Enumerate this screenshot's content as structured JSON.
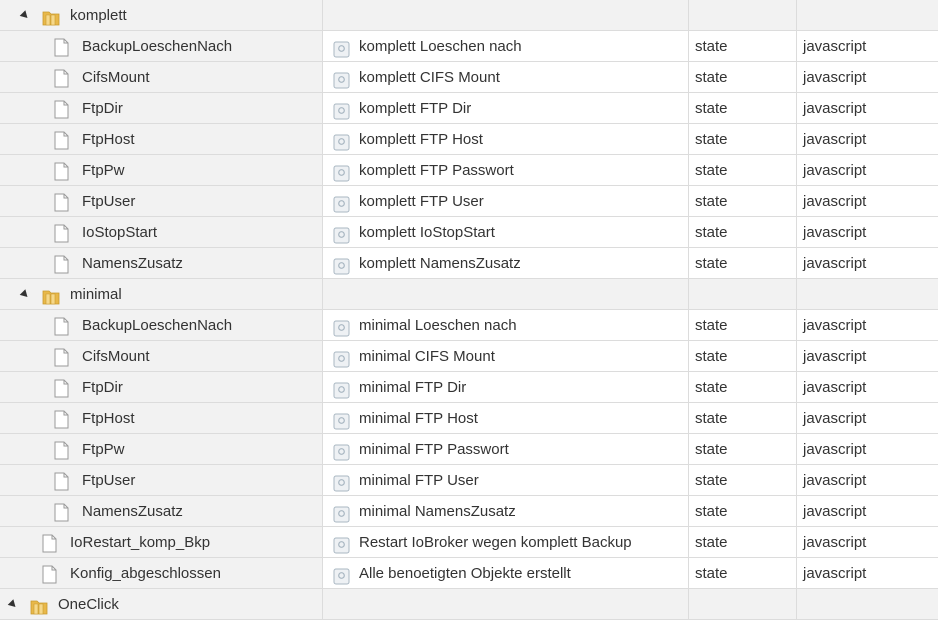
{
  "rows": [
    {
      "kind": "folder",
      "level": 1,
      "name": "komplett"
    },
    {
      "kind": "item",
      "level": 2,
      "name": "BackupLoeschenNach",
      "desc": "komplett Loeschen nach",
      "type": "state",
      "role": "javascript"
    },
    {
      "kind": "item",
      "level": 2,
      "name": "CifsMount",
      "desc": "komplett CIFS Mount",
      "type": "state",
      "role": "javascript"
    },
    {
      "kind": "item",
      "level": 2,
      "name": "FtpDir",
      "desc": "komplett FTP Dir",
      "type": "state",
      "role": "javascript"
    },
    {
      "kind": "item",
      "level": 2,
      "name": "FtpHost",
      "desc": "komplett FTP Host",
      "type": "state",
      "role": "javascript"
    },
    {
      "kind": "item",
      "level": 2,
      "name": "FtpPw",
      "desc": "komplett FTP Passwort",
      "type": "state",
      "role": "javascript"
    },
    {
      "kind": "item",
      "level": 2,
      "name": "FtpUser",
      "desc": "komplett FTP User",
      "type": "state",
      "role": "javascript"
    },
    {
      "kind": "item",
      "level": 2,
      "name": "IoStopStart",
      "desc": "komplett IoStopStart",
      "type": "state",
      "role": "javascript"
    },
    {
      "kind": "item",
      "level": 2,
      "name": "NamensZusatz",
      "desc": "komplett NamensZusatz",
      "type": "state",
      "role": "javascript"
    },
    {
      "kind": "folder",
      "level": 1,
      "name": "minimal"
    },
    {
      "kind": "item",
      "level": 2,
      "name": "BackupLoeschenNach",
      "desc": "minimal Loeschen nach",
      "type": "state",
      "role": "javascript"
    },
    {
      "kind": "item",
      "level": 2,
      "name": "CifsMount",
      "desc": "minimal CIFS Mount",
      "type": "state",
      "role": "javascript"
    },
    {
      "kind": "item",
      "level": 2,
      "name": "FtpDir",
      "desc": "minimal FTP Dir",
      "type": "state",
      "role": "javascript"
    },
    {
      "kind": "item",
      "level": 2,
      "name": "FtpHost",
      "desc": "minimal FTP Host",
      "type": "state",
      "role": "javascript"
    },
    {
      "kind": "item",
      "level": 2,
      "name": "FtpPw",
      "desc": "minimal FTP Passwort",
      "type": "state",
      "role": "javascript"
    },
    {
      "kind": "item",
      "level": 2,
      "name": "FtpUser",
      "desc": "minimal FTP User",
      "type": "state",
      "role": "javascript"
    },
    {
      "kind": "item",
      "level": 2,
      "name": "NamensZusatz",
      "desc": "minimal NamensZusatz",
      "type": "state",
      "role": "javascript"
    },
    {
      "kind": "item",
      "level": 1,
      "name": "IoRestart_komp_Bkp",
      "desc": "Restart IoBroker wegen komplett Backup",
      "type": "state",
      "role": "javascript"
    },
    {
      "kind": "item",
      "level": 1,
      "name": "Konfig_abgeschlossen",
      "desc": "Alle benoetigten Objekte erstellt",
      "type": "state",
      "role": "javascript"
    },
    {
      "kind": "folder",
      "level": 0,
      "name": "OneClick"
    }
  ],
  "icons": {
    "folder": "folder-icon",
    "file": "file-icon",
    "state": "state-icon",
    "expand": "expand-toggle-icon"
  },
  "colors": {
    "folder": "#e8b84a",
    "grid": "#dcdcdc",
    "state_icon": "#a9b7c2"
  }
}
